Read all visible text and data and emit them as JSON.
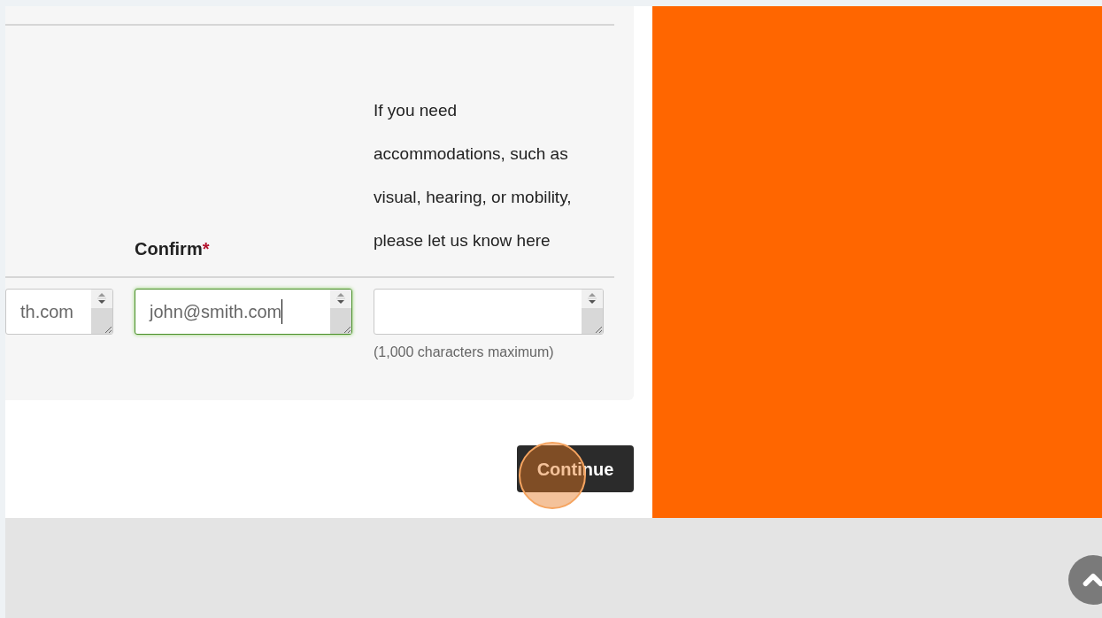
{
  "form": {
    "columns": [
      {
        "value": "th.com",
        "focused": false
      },
      {
        "label": "Confirm",
        "required_mark": "*",
        "value": "john@smith.com",
        "focused": true
      },
      {
        "label": "If you need accommodations, such as visual, hearing, or mobility, please let us know here",
        "focused": false,
        "note": "(1,000 characters maximum)"
      }
    ]
  },
  "continue_button": {
    "label": "Continue",
    "highlighted": true
  }
}
